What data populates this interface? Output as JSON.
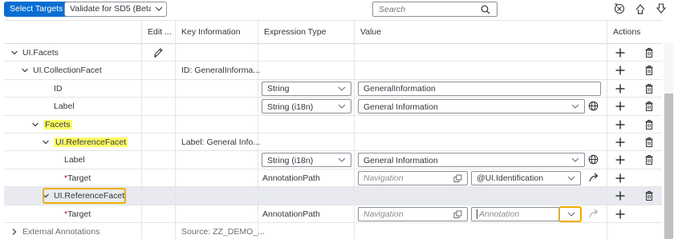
{
  "toolbar": {
    "select_targets": "Select Targets",
    "validate": "Validate for SD5 (Beta)",
    "search_placeholder": "Search"
  },
  "columns": [
    "Edit ...",
    "Key Information",
    "Expression Type",
    "Value",
    "Actions"
  ],
  "rows": [
    {
      "label": "UI.Facets",
      "indent": 0,
      "expander": "down",
      "edit": true,
      "key": "",
      "expr": "",
      "value": "",
      "add": true,
      "del": true
    },
    {
      "label": "UI.CollectionFacet",
      "indent": 1,
      "expander": "down",
      "key": "ID: GeneralInforma...",
      "add": true,
      "del": true
    },
    {
      "label": "ID",
      "indent": 3,
      "expr": "String",
      "value_text": "GeneralInformation",
      "add": true,
      "del": true
    },
    {
      "label": "Label",
      "indent": 3,
      "expr": "String (i18n)",
      "value_text": "General Information",
      "value_select": true,
      "globe": true,
      "add": true,
      "del": true
    },
    {
      "label": "Facets",
      "indent": 2,
      "expander": "down",
      "highlight": true,
      "add": true,
      "del": true
    },
    {
      "label": "UI.ReferenceFacet",
      "indent": 3,
      "expander": "down",
      "highlight": true,
      "key": "Label: General Info...",
      "add": true,
      "del": true
    },
    {
      "label": "Label",
      "indent": 4,
      "expr": "String (i18n)",
      "value_text": "General Information",
      "value_select": true,
      "globe": true,
      "add": true,
      "del": true
    },
    {
      "label": "Target",
      "indent": 4,
      "required": true,
      "expr_static": "AnnotationPath",
      "nav_placeholder": "Navigation",
      "annotation": "@UI.Identification",
      "arrow": true,
      "add": true
    },
    {
      "label": "UI.ReferenceFacet",
      "indent": 3,
      "expander": "down",
      "selected": true,
      "boxed": true,
      "add": true,
      "del": true
    },
    {
      "label": "Target",
      "indent": 4,
      "required": true,
      "expr_static": "AnnotationPath",
      "nav_placeholder": "Navigation",
      "annotation_placeholder": "Annotation",
      "arrow_disabled": true,
      "add": true
    },
    {
      "label": "External Annotations",
      "indent": 0,
      "expander": "right",
      "muted": true,
      "key": "Source: ZZ_DEMO_..."
    }
  ]
}
